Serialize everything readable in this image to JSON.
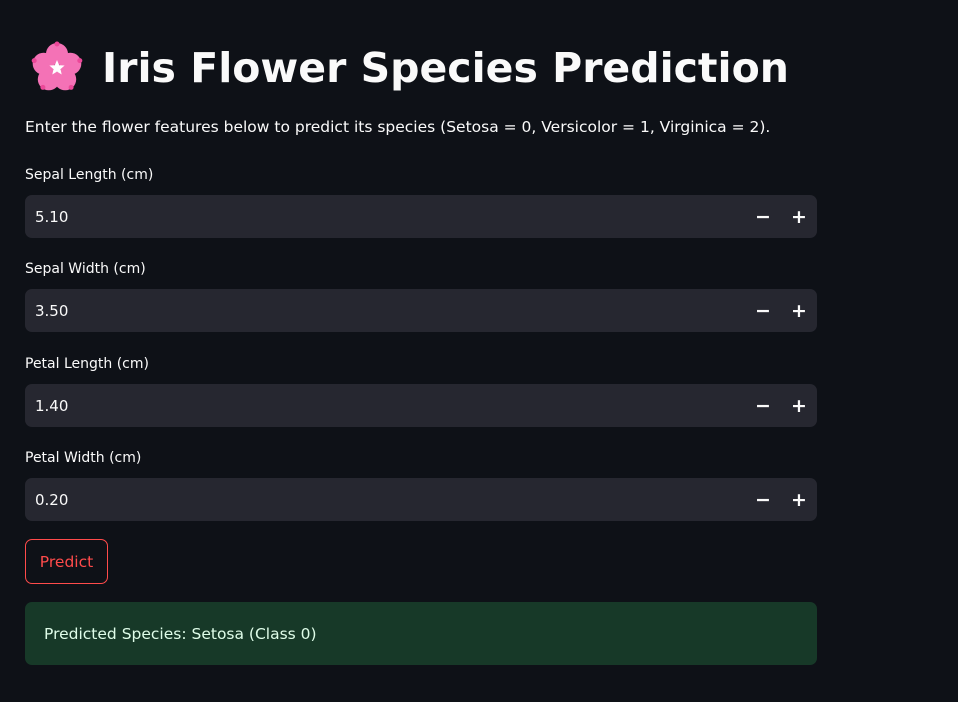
{
  "header": {
    "title": "Iris Flower Species Prediction",
    "icon": "cherry-blossom-icon"
  },
  "intro": {
    "text": "Enter the flower features below to predict its species (Setosa = 0, Versicolor = 1, Virginica = 2)."
  },
  "fields": [
    {
      "label": "Sepal Length (cm)",
      "value": "5.10",
      "minus": "−",
      "plus": "+"
    },
    {
      "label": "Sepal Width (cm)",
      "value": "3.50",
      "minus": "−",
      "plus": "+"
    },
    {
      "label": "Petal Length (cm)",
      "value": "1.40",
      "minus": "−",
      "plus": "+"
    },
    {
      "label": "Petal Width (cm)",
      "value": "0.20",
      "minus": "−",
      "plus": "+"
    }
  ],
  "predict_button": {
    "label": "Predict"
  },
  "result": {
    "text": "Predicted Species: Setosa (Class 0)"
  },
  "colors": {
    "background": "#0e1117",
    "input_background": "#262730",
    "accent": "#ff4b4b",
    "success_background": "#173928",
    "success_text": "#dffde9",
    "flower_pink": "#f472b6"
  }
}
